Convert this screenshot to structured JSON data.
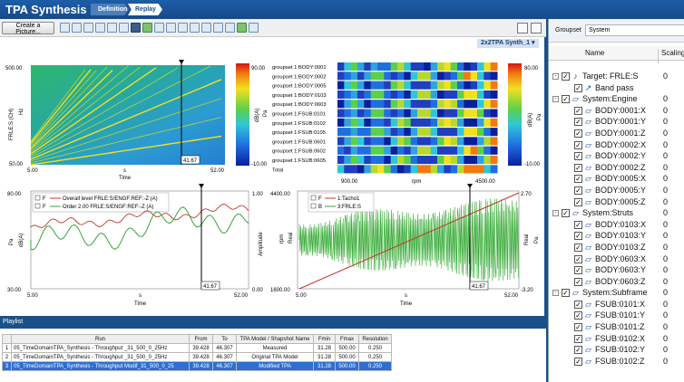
{
  "app": {
    "title": "TPA Synthesis",
    "crumbs": [
      "Definition",
      "Replay"
    ],
    "create_picture": "Create a Picture...",
    "synth_tab": "2x2TPA Synth_1 ▾"
  },
  "spectrogram": {
    "ylabel": "FRLE:S (CH)",
    "yunit": "Hz",
    "ytick_top": "500.00",
    "ytick_bottom": "50.00",
    "xtick_left": "5.00",
    "xunit": "s",
    "xtick_right": "52.00",
    "xlabel": "Time",
    "cursor": "41.67",
    "colorbar_top": "90.00",
    "colorbar_bottom": "-10.00",
    "colorbar_unit": "dB(A)",
    "colorbar_unit2": "Pa"
  },
  "contribution_map": {
    "rows": [
      "groupset 1:BODY:0001",
      "groupset 1:BODY:0002",
      "groupset 1:BODY:0005",
      "groupset 1:BODY:0103",
      "groupset 1:BODY:0603",
      "groupset 1:FSUB:0101",
      "groupset 1:FSUB:0102",
      "groupset 1:FSUB:0105",
      "groupset 1:FSUB:0601",
      "groupset 1:FSUB:0602",
      "groupset 1:FSUB:0605",
      "Total"
    ],
    "xtick_left": "900.00",
    "xunit": "rpm",
    "xtick_right": "4500.00",
    "colorbar_top": "80.00",
    "colorbar_bottom": "-10.00",
    "colorbar_unit": "dB(A)",
    "colorbar_unit2": "Pa"
  },
  "overall_plot": {
    "legend": [
      {
        "flag": "F",
        "label": "Overall level FRLE:S/ENGF:REF:-Z (A)",
        "color": "#c0392b"
      },
      {
        "flag": "F",
        "label": "Order 2.00 FRLE:S/ENGF:REF:-Z (A)",
        "color": "#3aa33a"
      }
    ],
    "ytick_top": "80.00",
    "ytick_bottom": "30.00",
    "ylabel": "dB(A)",
    "yunit": "Pa",
    "y2tick_top": "1.00",
    "y2tick_bottom": "0.00",
    "y2label": "Amplitude",
    "xtick_left": "5.00",
    "xunit": "s",
    "xtick_right": "52.00",
    "xlabel": "Time",
    "cursor": "41.67"
  },
  "tacho_plot": {
    "legend": [
      {
        "flag": "F",
        "label": "1:Tacho1",
        "color": "#c0392b"
      },
      {
        "flag": "B",
        "label": "3:FRLE:S",
        "color": "#2fa82f"
      }
    ],
    "ytick_top": "4400.00",
    "ytick_bottom": "1600.00",
    "ylabel": "rpm",
    "yunit": "Real",
    "y2tick_top": "2.70",
    "y2tick_bottom": "-3.20",
    "y2label": "Real",
    "y2unit": "Pa",
    "xtick_left": "5.00",
    "xunit": "s",
    "xtick_right": "52.00",
    "xlabel": "Time",
    "cursor": "41.67"
  },
  "playlist": {
    "title": "Playlist",
    "columns": [
      "",
      "Run",
      "From",
      "To",
      "TPA Model / Shapshot Name",
      "Fmin",
      "Fmax",
      "Resolution"
    ],
    "rows": [
      [
        "1",
        "05_TimeDomainTPA_Synthesis - Throughput _31_500_0_25Hz",
        "39.428",
        "46.307",
        "Measured",
        "31.28",
        "500.00",
        "0.250"
      ],
      [
        "2",
        "05_TimeDomainTPA_Synthesis - Throughput _31_500_0_25Hz",
        "39.428",
        "46.307",
        "Original TPA Model",
        "31.28",
        "500.00",
        "0.250"
      ],
      [
        "3",
        "05_TimeDomainTPA_Synthesis - Throughput Modif_31_500_0_25",
        "39.428",
        "46.307",
        "Modified TPA",
        "31.28",
        "500.00",
        "0.250"
      ]
    ],
    "selected_row": 2
  },
  "right_panel": {
    "groupset_label": "Groupset",
    "groupset_value": "System",
    "col_name": "Name",
    "col_scaling": "Scaling",
    "tree": [
      {
        "level": 0,
        "expander": "-",
        "checked": true,
        "icon": "♪",
        "label": "Target: FRLE:S",
        "value": "0"
      },
      {
        "level": 1,
        "expander": "",
        "checked": true,
        "icon": "↗",
        "label": "Band pass",
        "value": ""
      },
      {
        "level": 0,
        "expander": "-",
        "checked": true,
        "icon": "▱",
        "label": "System:Engine",
        "value": "0"
      },
      {
        "level": 1,
        "expander": "",
        "checked": true,
        "icon": "▱",
        "label": "BODY:0001:X",
        "value": "0"
      },
      {
        "level": 1,
        "expander": "",
        "checked": true,
        "icon": "▱",
        "label": "BODY:0001:Y",
        "value": "0"
      },
      {
        "level": 1,
        "expander": "",
        "checked": true,
        "icon": "▱",
        "label": "BODY:0001:Z",
        "value": "0"
      },
      {
        "level": 1,
        "expander": "",
        "checked": true,
        "icon": "▱",
        "label": "BODY:0002:X",
        "value": "0"
      },
      {
        "level": 1,
        "expander": "",
        "checked": true,
        "icon": "▱",
        "label": "BODY:0002:Y",
        "value": "0"
      },
      {
        "level": 1,
        "expander": "",
        "checked": true,
        "icon": "▱",
        "label": "BODY:0002:Z",
        "value": "0"
      },
      {
        "level": 1,
        "expander": "",
        "checked": true,
        "icon": "▱",
        "label": "BODY:0005:X",
        "value": "0"
      },
      {
        "level": 1,
        "expander": "",
        "checked": true,
        "icon": "▱",
        "label": "BODY:0005:Y",
        "value": "0"
      },
      {
        "level": 1,
        "expander": "",
        "checked": true,
        "icon": "▱",
        "label": "BODY:0005:Z",
        "value": "0"
      },
      {
        "level": 0,
        "expander": "-",
        "checked": true,
        "icon": "▱",
        "label": "System:Struts",
        "value": "0"
      },
      {
        "level": 1,
        "expander": "",
        "checked": true,
        "icon": "▱",
        "label": "BODY:0103:X",
        "value": "0"
      },
      {
        "level": 1,
        "expander": "",
        "checked": true,
        "icon": "▱",
        "label": "BODY:0103:Y",
        "value": "0"
      },
      {
        "level": 1,
        "expander": "",
        "checked": true,
        "icon": "▱",
        "label": "BODY:0103:Z",
        "value": "0"
      },
      {
        "level": 1,
        "expander": "",
        "checked": true,
        "icon": "▱",
        "label": "BODY:0603:X",
        "value": "0"
      },
      {
        "level": 1,
        "expander": "",
        "checked": true,
        "icon": "▱",
        "label": "BODY:0603:Y",
        "value": "0"
      },
      {
        "level": 1,
        "expander": "",
        "checked": true,
        "icon": "▱",
        "label": "BODY:0603:Z",
        "value": "0"
      },
      {
        "level": 0,
        "expander": "-",
        "checked": true,
        "icon": "▱",
        "label": "System:Subframe",
        "value": "0"
      },
      {
        "level": 1,
        "expander": "",
        "checked": true,
        "icon": "▱",
        "label": "FSUB:0101:X",
        "value": "0"
      },
      {
        "level": 1,
        "expander": "",
        "checked": true,
        "icon": "▱",
        "label": "FSUB:0101:Y",
        "value": "0"
      },
      {
        "level": 1,
        "expander": "",
        "checked": true,
        "icon": "▱",
        "label": "FSUB:0101:Z",
        "value": "0"
      },
      {
        "level": 1,
        "expander": "",
        "checked": true,
        "icon": "▱",
        "label": "FSUB:0102:X",
        "value": "0"
      },
      {
        "level": 1,
        "expander": "",
        "checked": true,
        "icon": "▱",
        "label": "FSUB:0102:Y",
        "value": "0"
      },
      {
        "level": 1,
        "expander": "",
        "checked": true,
        "icon": "▱",
        "label": "FSUB:0102:Z",
        "value": "0"
      }
    ]
  },
  "colors": {
    "brand_blue": "#1b4f8a",
    "overall_red": "#c0392b",
    "order_green": "#3aa33a",
    "signal_green": "#2fa82f",
    "selection_blue": "#2f6fd1"
  }
}
